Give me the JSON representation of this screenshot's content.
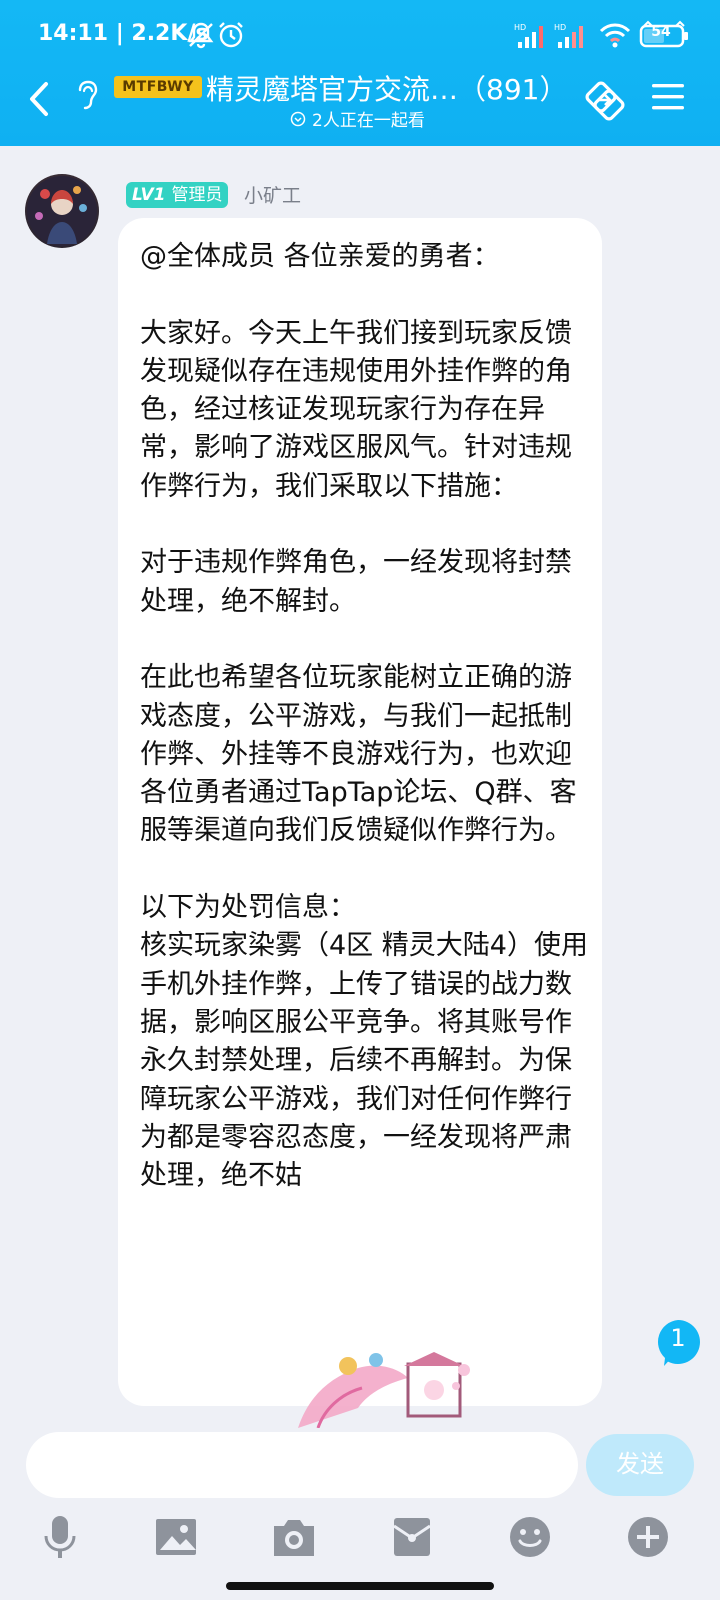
{
  "status_bar": {
    "time_speed": "14:11 | 2.2K/s",
    "signal_label_1": "HD",
    "signal_label_2": "HD",
    "battery": "54",
    "icons": [
      "bell-muted-icon",
      "alarm-icon",
      "signal-icon",
      "signal-icon",
      "wifi-icon",
      "battery-icon"
    ]
  },
  "header": {
    "logo_text": "MTFBWY",
    "title": "精灵魔塔官方交流…（891）",
    "subtitle": "2人正在一起看",
    "icons": [
      "back-icon",
      "earpiece-icon",
      "watch-together-icon",
      "share-screen-icon",
      "menu-icon"
    ]
  },
  "message": {
    "level": "LV1",
    "role": "管理员",
    "sender": "小矿工",
    "text": "@全体成员 各位亲爱的勇者：\n\n大家好。今天上午我们接到玩家反馈发现疑似存在违规使用外挂作弊的角色，经过核证发现玩家行为存在异常，影响了游戏区服风气。针对违规作弊行为，我们采取以下措施：\n\n对于违规作弊角色，一经发现将封禁处理，绝不解封。\n\n在此也希望各位玩家能树立正确的游戏态度，公平游戏，与我们一起抵制作弊、外挂等不良游戏行为，也欢迎各位勇者通过TapTap论坛、Q群、客服等渠道向我们反馈疑似作弊行为。\n\n以下为处罚信息：\n核实玩家染雾（4区 精灵大陆4）使用手机外挂作弊，上传了错误的战力数据，影响区服公平竞争。将其账号作永久封禁处理，后续不再解封。为保障玩家公平游戏，我们对任何作弊行为都是零容忍态度，一经发现将严肃处理，绝不姑"
  },
  "unread_count": "1",
  "input": {
    "placeholder": "",
    "send_label": "发送"
  },
  "toolbar": {
    "icons": [
      "microphone-icon",
      "image-icon",
      "camera-icon",
      "red-packet-icon",
      "emoji-icon",
      "plus-icon"
    ]
  },
  "colors": {
    "header": "#14b8f5",
    "background": "#eef0f6",
    "badge": "#33d2c3",
    "send_disabled": "#bfe9fb",
    "unread": "#12b7f5"
  }
}
